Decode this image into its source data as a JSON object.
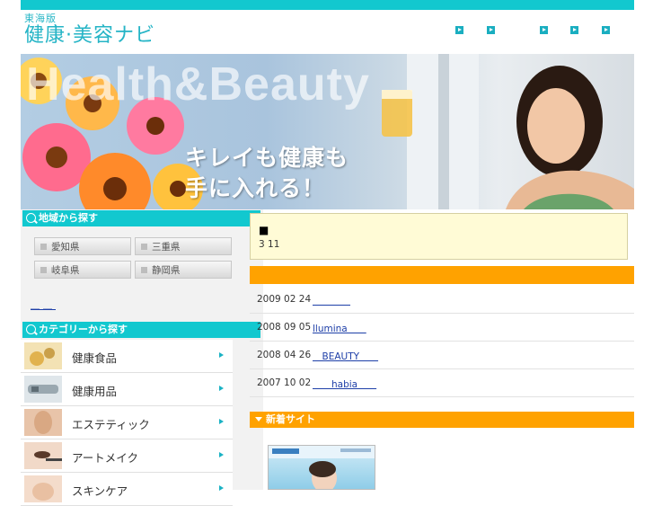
{
  "header": {
    "edition": "東海版",
    "site_title": "健康·美容ナビ"
  },
  "hero": {
    "title": "Health&Beauty",
    "line1": "キレイも健康も",
    "line2": "手に入れる！"
  },
  "sidebar": {
    "region_heading": "地域から探す",
    "prefectures": [
      "愛知県",
      "三重県",
      "岐阜県",
      "静岡県"
    ],
    "small_links": "＿＿",
    "category_heading": "カテゴリーから探す",
    "categories": [
      "健康食品",
      "健康用品",
      "エステティック",
      "アートメイク",
      "スキンケア"
    ]
  },
  "notice": {
    "mark": "■",
    "text": "3 11"
  },
  "news": [
    {
      "date": "2009 02 24",
      "link": "　　　　"
    },
    {
      "date": "2008 09 05",
      "link": "llumina　　"
    },
    {
      "date": "2008 04 26",
      "link": "　BEAUTY　　"
    },
    {
      "date": "2007 10 02",
      "link": "　　habia　　"
    }
  ],
  "new_sites": {
    "heading": "新着サイト"
  },
  "colors": {
    "accent": "#12c8cf",
    "orange": "#ffa200",
    "notice_bg": "#fffbd6"
  }
}
